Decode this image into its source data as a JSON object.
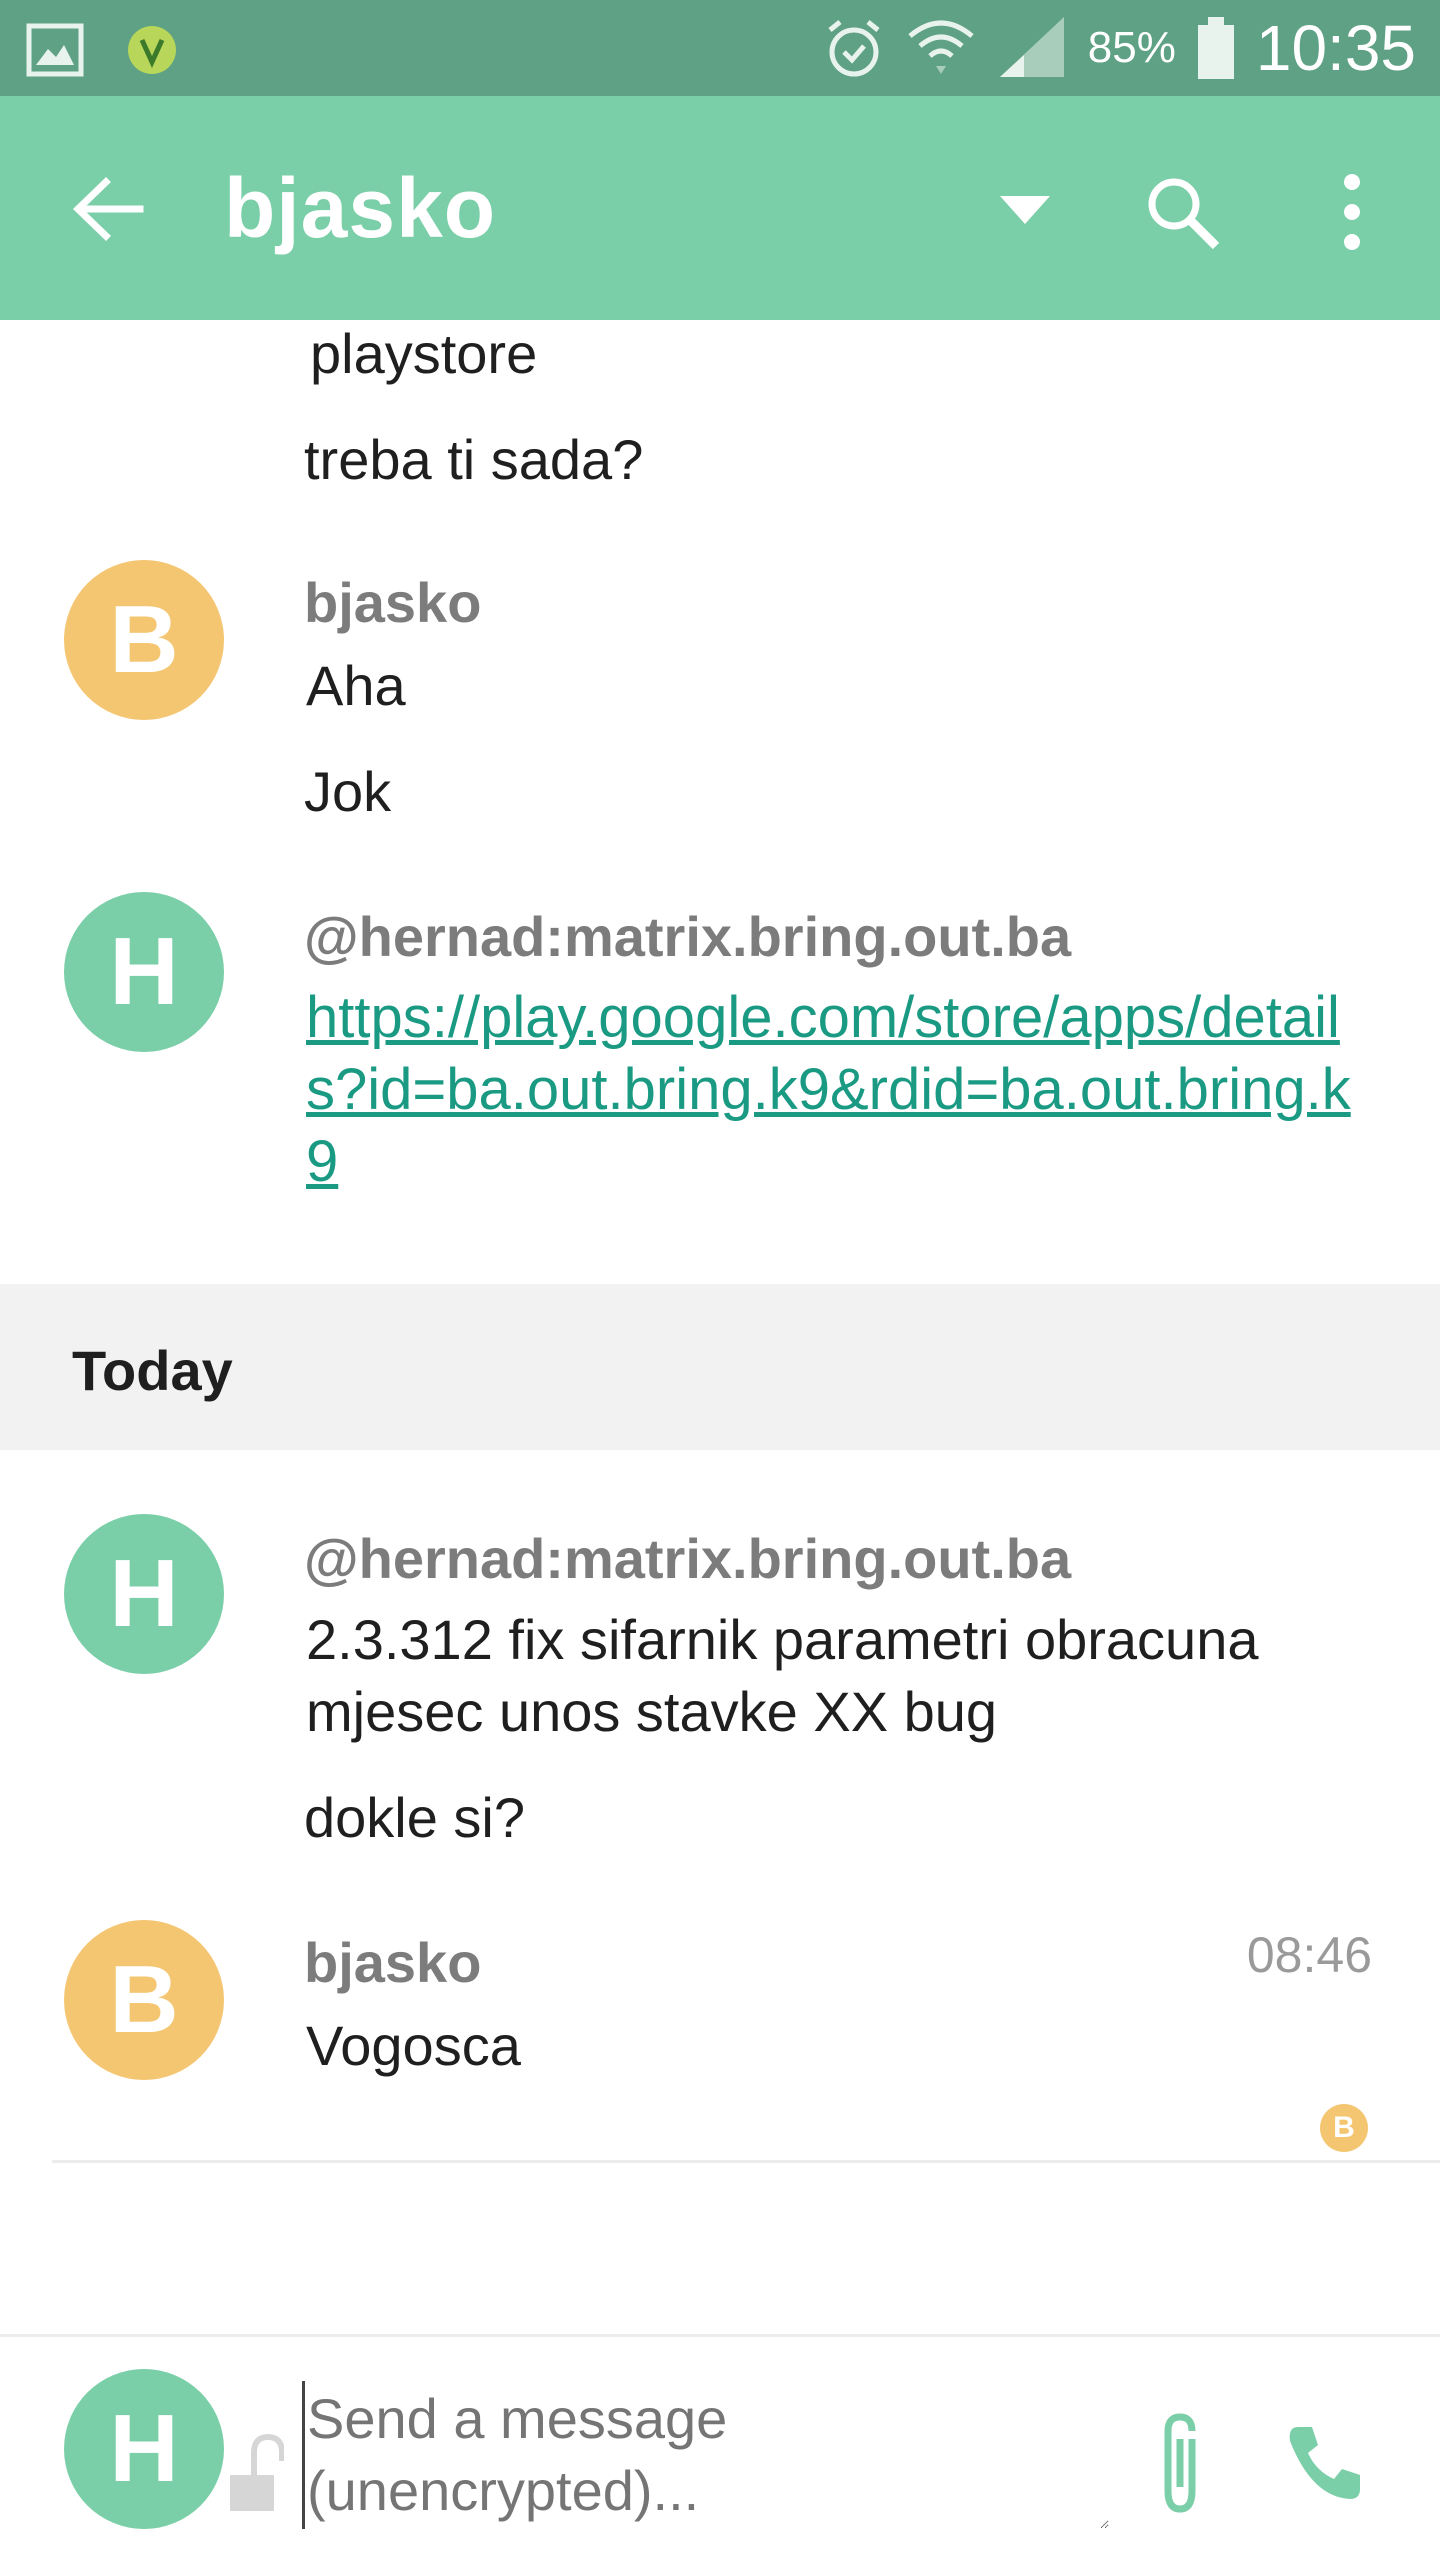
{
  "status_bar": {
    "battery_percent": "85%",
    "clock": "10:35",
    "icons": [
      "gallery-icon",
      "app-icon",
      "alarm-icon",
      "wifi-icon",
      "signal-icon",
      "battery-icon"
    ]
  },
  "app_bar": {
    "title": "bjasko",
    "icons": [
      "back-arrow-icon",
      "dropdown-icon",
      "search-icon",
      "more-icon"
    ]
  },
  "timeline": {
    "earlier": {
      "continued_messages": [
        "playstore",
        "treba ti sada?"
      ],
      "group_bjasko": {
        "avatar_letter": "B",
        "sender": "bjasko",
        "messages": [
          "Aha",
          "Jok"
        ]
      },
      "group_hernad": {
        "avatar_letter": "H",
        "sender": "@hernad:matrix.bring.out.ba",
        "link": "https://play.google.com/store/apps/details?id=ba.out.bring.k9&rdid=ba.out.bring.k9"
      }
    },
    "date_separator": "Today",
    "today": {
      "group_hernad": {
        "avatar_letter": "H",
        "sender": "@hernad:matrix.bring.out.ba",
        "messages": [
          "2.3.312 fix sifarnik parametri obracuna mjesec unos stavke XX bug",
          "dokle si?"
        ]
      },
      "group_bjasko": {
        "avatar_letter": "B",
        "sender": "bjasko",
        "time": "08:46",
        "messages": [
          "Vogosca"
        ],
        "read_receipt_letter": "B"
      }
    }
  },
  "composer": {
    "avatar_letter": "H",
    "placeholder": "Send a message (unencrypted)...",
    "icons": [
      "lock-open-icon",
      "attach-icon",
      "call-icon"
    ]
  },
  "colors": {
    "status_bar": "#5fa184",
    "app_bar": "#7acfa8",
    "avatar_b": "#f5c672",
    "avatar_h": "#7acfa8",
    "link": "#1a9a83"
  }
}
